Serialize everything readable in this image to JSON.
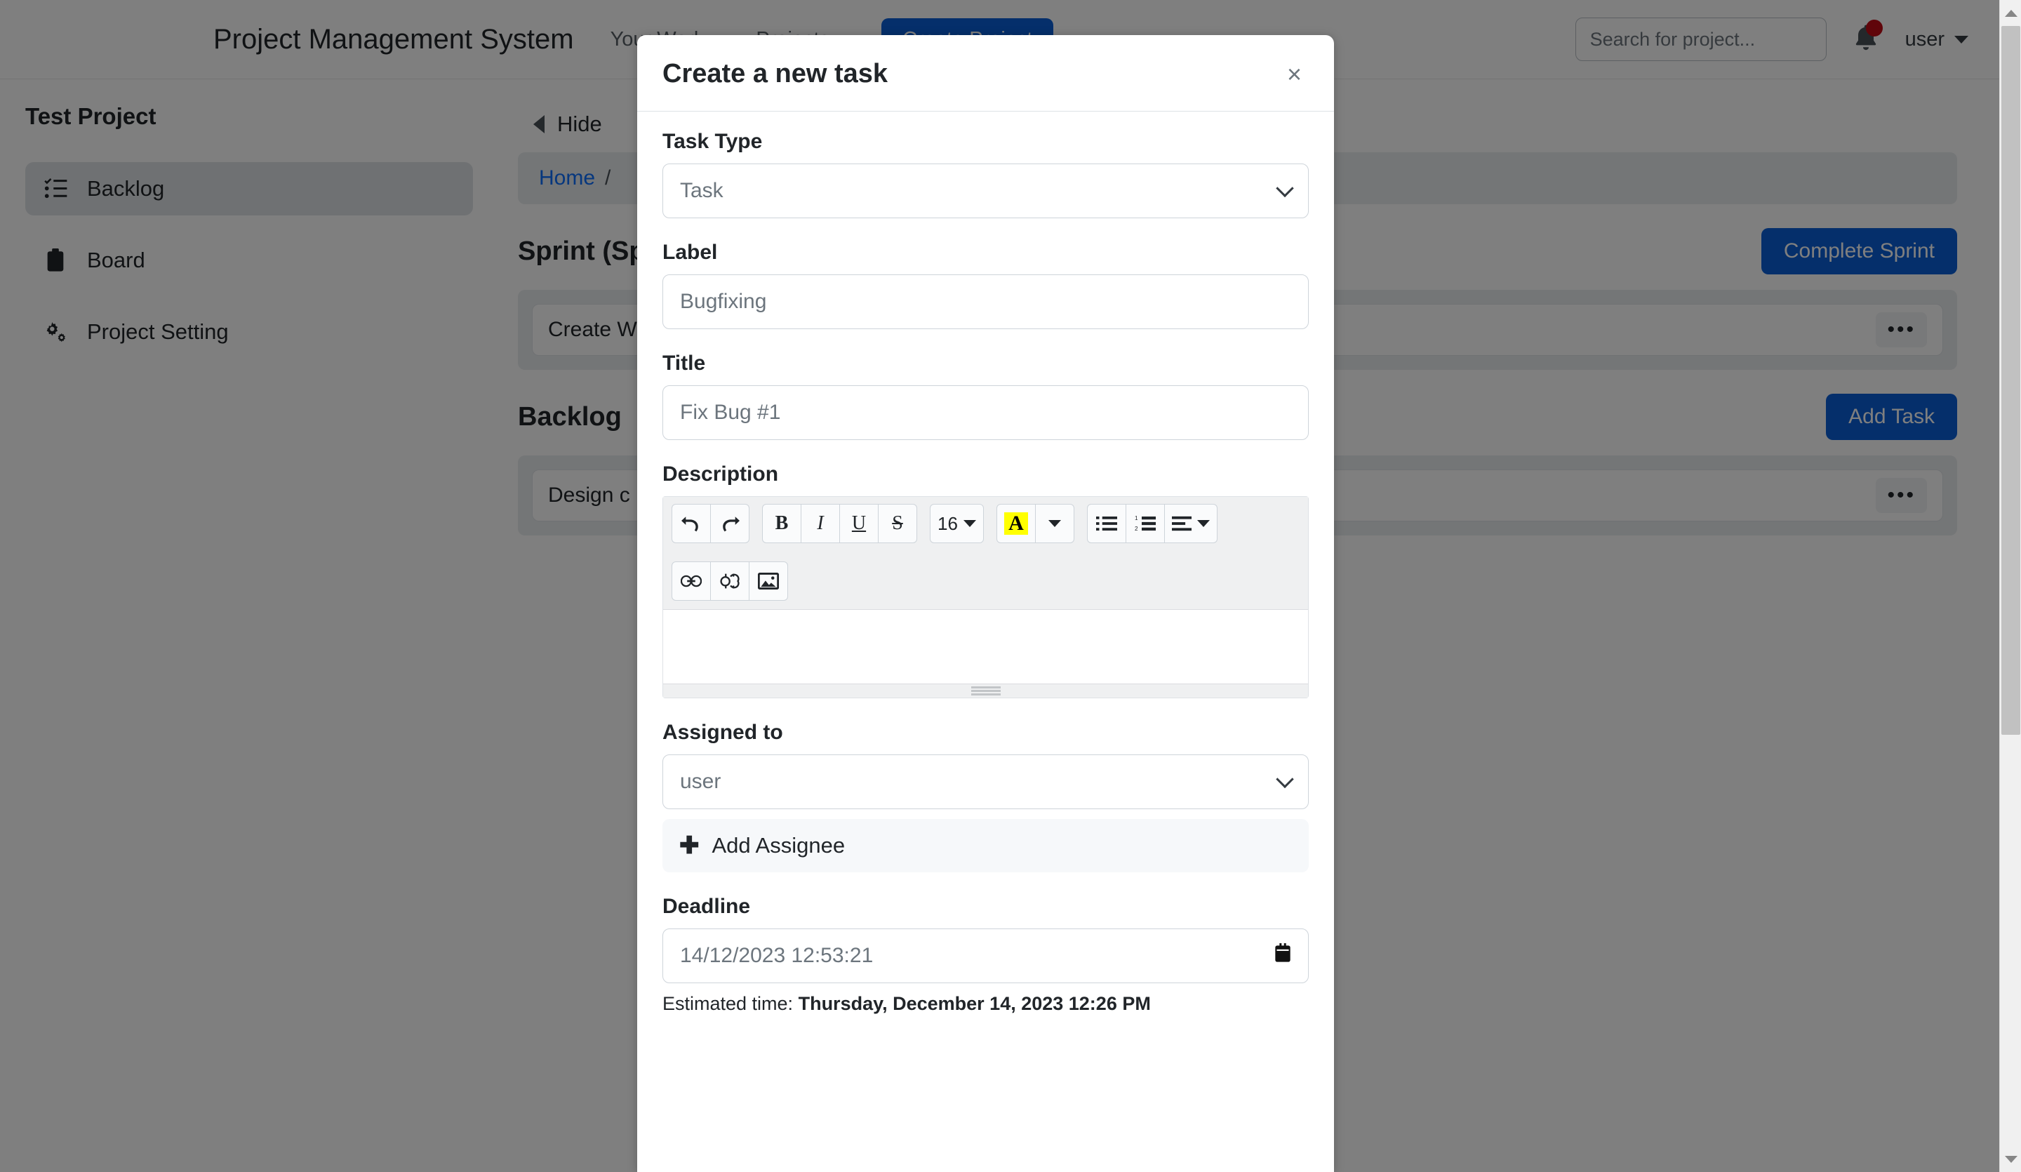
{
  "navbar": {
    "brand": "Project Management System",
    "links": [
      {
        "label": "Your Work"
      },
      {
        "label": "Projects"
      }
    ],
    "create_project_label": "Create Project",
    "search_placeholder": "Search for project...",
    "user_label": "user"
  },
  "sidebar": {
    "project_title": "Test Project",
    "items": [
      {
        "label": "Backlog",
        "icon": "list-check-icon",
        "active": true
      },
      {
        "label": "Board",
        "icon": "clipboard-icon",
        "active": false
      },
      {
        "label": "Project Setting",
        "icon": "gears-icon",
        "active": false
      }
    ]
  },
  "content": {
    "hide_label": "Hide",
    "breadcrumb": [
      "Home",
      "/"
    ],
    "sprint_title": "Sprint (Sp",
    "complete_sprint_label": "Complete Sprint",
    "sprint_task": "Create W",
    "backlog_title": "Backlog",
    "add_task_label": "Add Task",
    "backlog_task": "Design c",
    "dots_label": "•••"
  },
  "modal": {
    "title": "Create a new task",
    "close_label": "×",
    "task_type": {
      "label": "Task Type",
      "value": "Task"
    },
    "label_field": {
      "label": "Label",
      "value": "Bugfixing"
    },
    "title_field": {
      "label": "Title",
      "value": "Fix Bug #1"
    },
    "description": {
      "label": "Description",
      "content": "",
      "toolbar": {
        "undo": "undo-icon",
        "redo": "redo-icon",
        "bold": "B",
        "italic": "I",
        "underline": "U",
        "strike": "S",
        "font_size": "16",
        "highlight": "A",
        "bullet_list": "bullet-list-icon",
        "numbered_list": "numbered-list-icon",
        "align": "align-left-icon",
        "link": "link-icon",
        "unlink": "unlink-icon",
        "image": "image-icon"
      }
    },
    "assigned_to": {
      "label": "Assigned to",
      "value": "user"
    },
    "add_assignee_label": "Add Assignee",
    "deadline": {
      "label": "Deadline",
      "value": "14/12/2023 12:53:21",
      "estimated_prefix": "Estimated time:",
      "estimated_value": "Thursday, December 14, 2023 12:26 PM"
    }
  },
  "colors": {
    "primary": "#0b5ed7",
    "badge": "#c00b14",
    "highlight": "#ffff00",
    "link": "#0d6efd"
  }
}
